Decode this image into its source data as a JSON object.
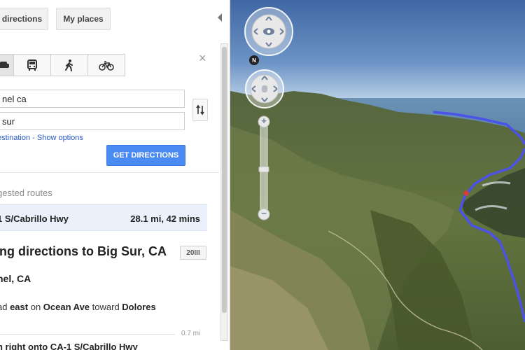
{
  "top_buttons": {
    "directions": "directions",
    "my_places": "My places"
  },
  "travel_modes": {
    "items": [
      "car-icon",
      "transit-icon",
      "walk-icon",
      "bicycle-icon"
    ],
    "active": 0
  },
  "close_symbol": "×",
  "form": {
    "origin_value": "nel ca",
    "destination_value": "sur",
    "add_destination": "estination",
    "link_separator": " - ",
    "show_options": "Show options",
    "get_directions": "GET DIRECTIONS"
  },
  "suggested": {
    "label": "gested routes",
    "route_name": "1 S/Cabrillo Hwy",
    "route_detail": "28.1 mi, 42 mins"
  },
  "directions": {
    "title": "ing directions to Big Sur, CA",
    "badge": "20III",
    "origin": "nel, CA"
  },
  "steps": [
    {
      "prefix": "ad ",
      "bold1": "east",
      "mid": " on ",
      "bold2": "Ocean Ave",
      "mid2": " toward ",
      "bold3": "Dolores",
      "distance": "0.7 mi"
    },
    {
      "text": "n right onto CA-1 S/Cabrillo Hwy"
    }
  ],
  "map": {
    "compass_letter": "N",
    "zoom_in": "+",
    "zoom_out": "−",
    "zoom_level": 0.5,
    "route_color": "#4b52e8",
    "marker_color": "#e53935"
  }
}
